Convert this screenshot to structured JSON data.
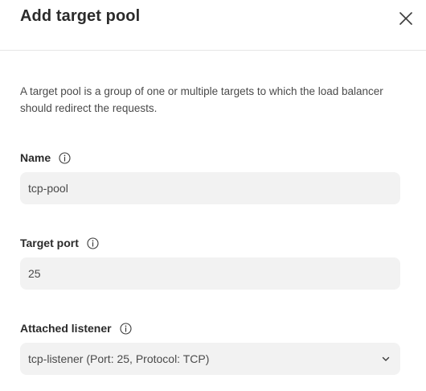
{
  "dialog": {
    "title": "Add target pool",
    "close_icon": "close-icon",
    "description": "A target pool is a group of one or multiple targets to which the load balancer should redirect the requests."
  },
  "fields": {
    "name": {
      "label": "Name",
      "value": "tcp-pool",
      "info_icon": "info-icon"
    },
    "target_port": {
      "label": "Target port",
      "value": "25",
      "info_icon": "info-icon"
    },
    "attached_listener": {
      "label": "Attached listener",
      "selected": "tcp-listener (Port: 25, Protocol: TCP)",
      "info_icon": "info-icon",
      "dropdown_icon": "chevron-down-icon"
    }
  },
  "colors": {
    "input_background": "#f2f2f2",
    "text_primary": "#2b2b2b",
    "text_secondary": "#4a4a4a",
    "divider": "#e6e6e6"
  }
}
